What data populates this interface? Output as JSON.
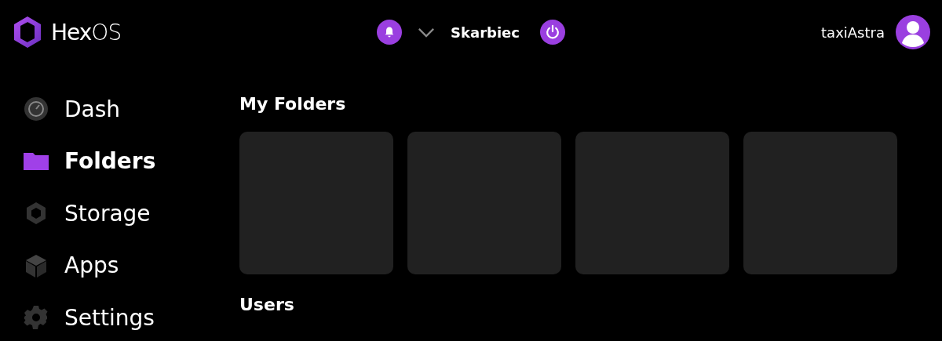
{
  "header": {
    "logo": "**Hex**OS",
    "server": "Skarbiec",
    "user": "taxiAstra"
  },
  "sidebar": {
    "items": [
      {
        "label": "Dash",
        "kind": "dash",
        "selected": false
      },
      {
        "label": "Folders",
        "kind": "folders",
        "selected": true
      },
      {
        "label": "Storage",
        "kind": "storage",
        "selected": false
      },
      {
        "label": "Apps",
        "kind": "apps",
        "selected": false
      },
      {
        "label": "Settings",
        "kind": "settings",
        "selected": false
      }
    ]
  },
  "main": {
    "sections": [
      {
        "title": "My Folders",
        "cards": [
          {
            "kind": "placeholder"
          },
          {
            "kind": "placeholder"
          },
          {
            "kind": "placeholder"
          },
          {
            "kind": "placeholder"
          }
        ]
      },
      {
        "title": "Users"
      }
    ]
  }
}
